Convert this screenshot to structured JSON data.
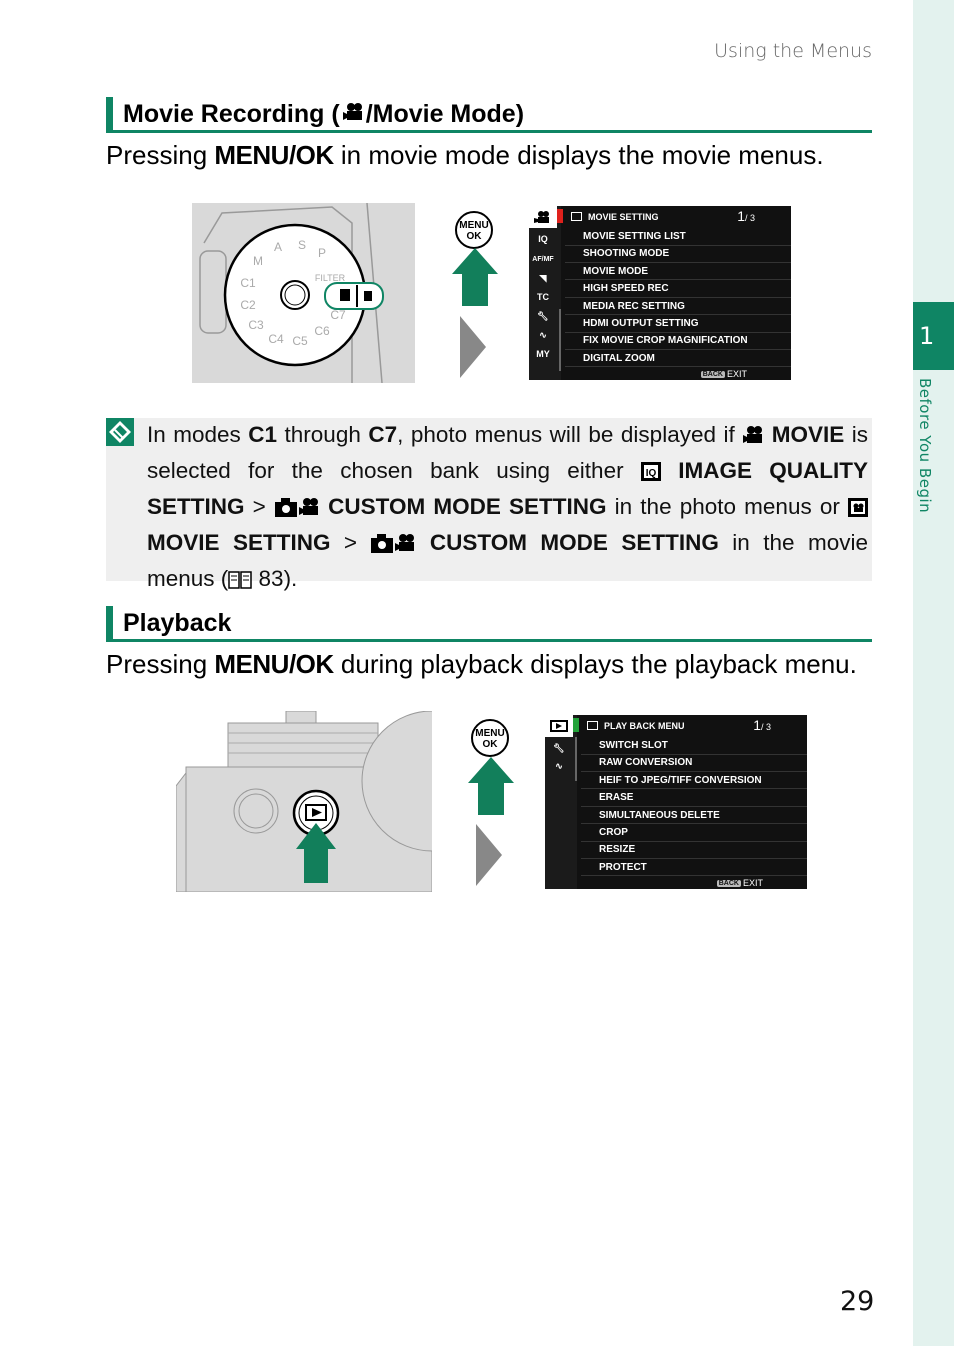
{
  "running_head": "Using the Menus",
  "page_number": "29",
  "chapter": {
    "number": "1",
    "label": "Before You Begin"
  },
  "colors": {
    "accent": "#0f8564",
    "note_bg": "#efefef",
    "sidebar_bg": "#e3f2ee",
    "movie_menu_tab_marker": "#e0211c",
    "playback_menu_tab_marker": "#23a23a"
  },
  "movie_section": {
    "heading_before": "Movie Recording (",
    "heading_icon": "movie-camera-icon",
    "heading_after": "/Movie Mode)",
    "intro_before": "Pressing ",
    "intro_key": "MENU/OK",
    "intro_after": " in movie mode displays the movie menus.",
    "button_label_line1": "MENU",
    "button_label_line2": "OK",
    "dial_labels": [
      "P",
      "S",
      "A",
      "M",
      "C1",
      "C2",
      "C3",
      "C4",
      "C5",
      "C6",
      "C7",
      "FILTER"
    ],
    "menu_screen": {
      "tabs": [
        "movie-icon",
        "IQ",
        "AF/MF",
        "mic-icon",
        "TC",
        "wrench-icon",
        "wave-icon",
        "MY"
      ],
      "header_icon": "movie-setting-icon",
      "header_label": "MOVIE SETTING",
      "page_current": "1",
      "page_total": "/ 3",
      "items": [
        "MOVIE SETTING LIST",
        "SHOOTING MODE",
        "MOVIE MODE",
        "HIGH SPEED REC",
        "MEDIA REC SETTING",
        "HDMI OUTPUT SETTING",
        "FIX MOVIE CROP MAGNIFICATION",
        "DIGITAL ZOOM"
      ],
      "footer_back": "BACK",
      "footer_exit": "EXIT"
    }
  },
  "note": {
    "icon": "note-pencil-icon",
    "t1": "In modes ",
    "c1": "C1",
    "t2": " through ",
    "c7": "C7",
    "t3": ", photo menus will be displayed if ",
    "movie_bold": "MOVIE",
    "t4": " is selected for the chosen bank using either ",
    "iq_bold": "IMAGE QUALITY SETTING",
    "gt1": " > ",
    "custom1_bold": "CUSTOM MODE SETTING",
    "t5": " in the photo menus or ",
    "movie_setting_bold": "MOVIE SETTING",
    "gt2": " > ",
    "custom2_bold": "CUSTOM MODE SETTING",
    "t6": " in the movie menus (",
    "page_ref": " 83",
    "t7": ")."
  },
  "playback_section": {
    "heading": "Playback",
    "intro_before": "Pressing ",
    "intro_key": "MENU/OK",
    "intro_after": " during playback displays the playback menu.",
    "button_label_line1": "MENU",
    "button_label_line2": "OK",
    "menu_screen": {
      "tabs": [
        "playback-icon",
        "wrench-icon",
        "wave-icon"
      ],
      "header_icon": "playback-icon",
      "header_label": "PLAY BACK MENU",
      "page_current": "1",
      "page_total": "/ 3",
      "items": [
        "SWITCH SLOT",
        "RAW CONVERSION",
        "HEIF TO JPEG/TIFF CONVERSION",
        "ERASE",
        "SIMULTANEOUS DELETE",
        "CROP",
        "RESIZE",
        "PROTECT"
      ],
      "footer_back": "BACK",
      "footer_exit": "EXIT"
    }
  }
}
